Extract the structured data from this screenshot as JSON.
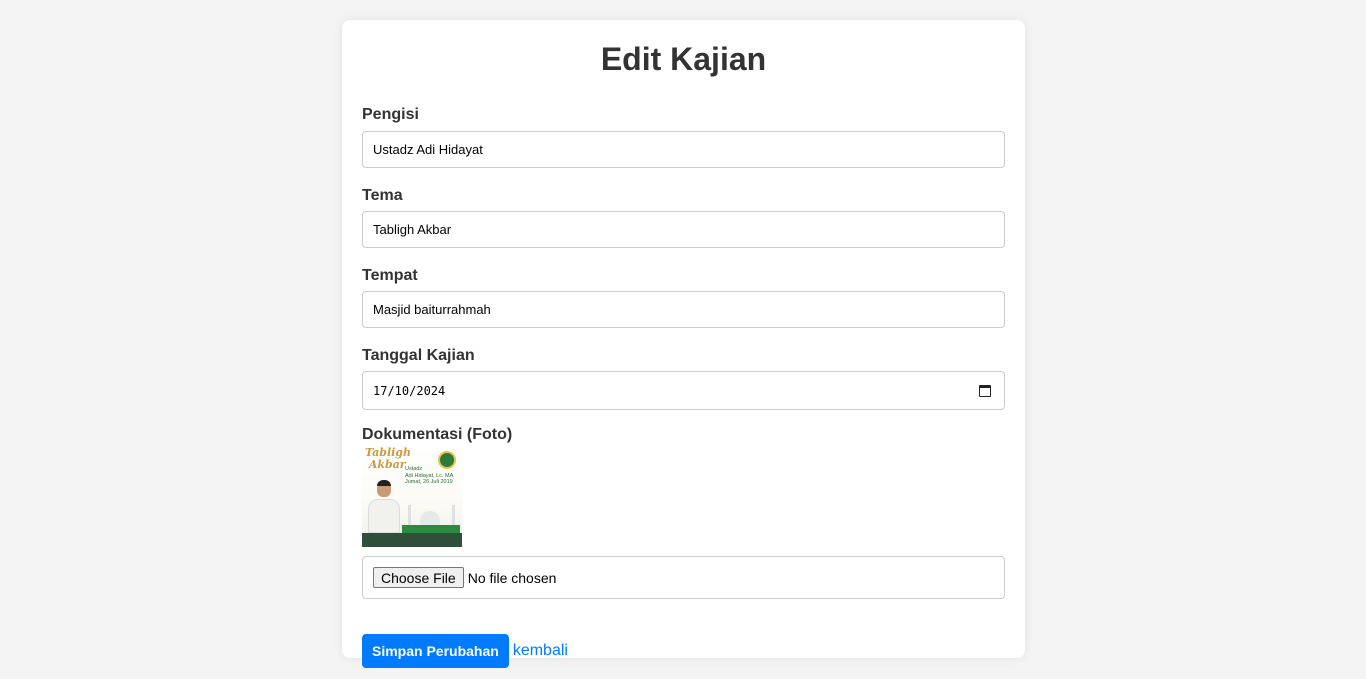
{
  "page_title": "Edit Kajian",
  "fields": {
    "pengisi": {
      "label": "Pengisi",
      "value": "Ustadz Adi Hidayat"
    },
    "tema": {
      "label": "Tema",
      "value": "Tabligh Akbar"
    },
    "tempat": {
      "label": "Tempat",
      "value": "Masjid baiturrahmah"
    },
    "tanggal": {
      "label": "Tanggal Kajian",
      "value": "17/10/2024",
      "icon": "calendar-icon"
    },
    "dokumentasi": {
      "label": "Dokumentasi (Foto)",
      "image": {
        "title_text": "Tabligh\n Akbar",
        "detail_text": "Ustadz\nAdi Hidayat, Lc. MA\nJumat, 26 Juli 2019"
      },
      "file_button": "Choose File",
      "file_status": "No file chosen"
    }
  },
  "actions": {
    "submit_label": "Simpan Perubahan",
    "back_label": "kembali"
  },
  "colors": {
    "primary": "#007bff",
    "background": "#f4f4f4",
    "card": "#ffffff"
  }
}
